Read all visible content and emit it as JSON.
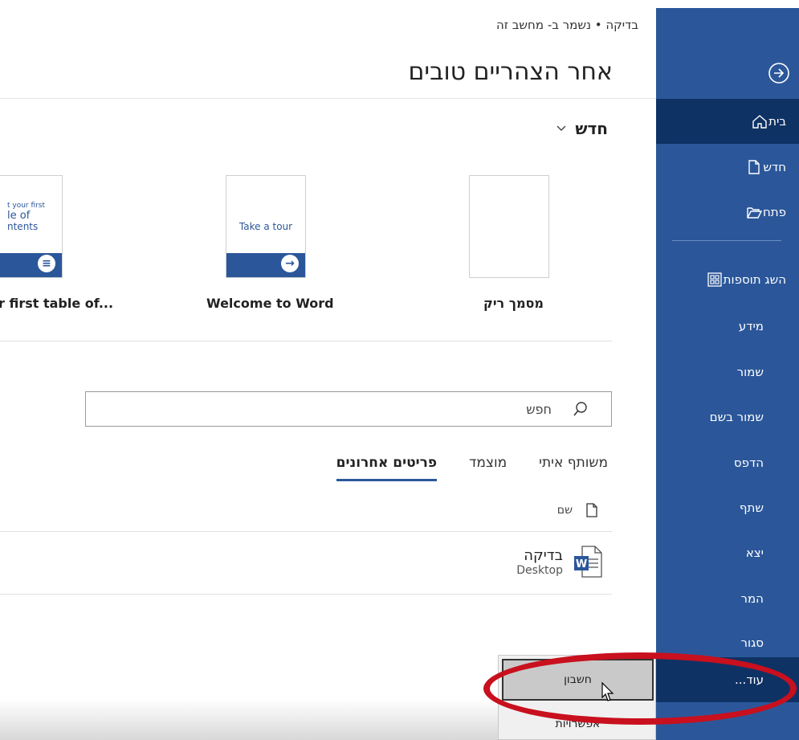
{
  "breadcrumb": "בדיקה • נשמר ב- מחשב זה",
  "greeting": "אחר הצהריים טובים",
  "sidebar": {
    "items": [
      {
        "label": "בית",
        "icon": "home-icon"
      },
      {
        "label": "חדש",
        "icon": "new-document-icon"
      },
      {
        "label": "פתח",
        "icon": "folder-open-icon"
      },
      {
        "label": "השג תוספות",
        "icon": "add-ins-icon"
      },
      {
        "label": "מידע"
      },
      {
        "label": "שמור"
      },
      {
        "label": "שמור בשם"
      },
      {
        "label": "הדפס"
      },
      {
        "label": "שתף"
      },
      {
        "label": "יצא"
      },
      {
        "label": "המר"
      },
      {
        "label": "סגור"
      },
      {
        "label": "עוד..."
      }
    ]
  },
  "new_section": {
    "title": "חדש",
    "templates": [
      {
        "caption": "מסמך ריק"
      },
      {
        "caption": "Welcome to Word",
        "thumb_text": "Take a tour"
      },
      {
        "caption": "r first table of...",
        "thumb_lines": [
          "t your first",
          "le of",
          "ntents"
        ]
      }
    ]
  },
  "search": {
    "placeholder": "חפש"
  },
  "tabs": [
    "פריטים אחרונים",
    "מוצמד",
    "משותף איתי"
  ],
  "list": {
    "header_name": "שם",
    "files": [
      {
        "name": "בדיקה",
        "location": "Desktop"
      }
    ]
  },
  "popup": {
    "account": "חשבון",
    "options": "אפשרויות"
  },
  "colors": {
    "accent": "#2b579a",
    "accent_dark": "#0f3264",
    "annotation": "#c8101e"
  }
}
